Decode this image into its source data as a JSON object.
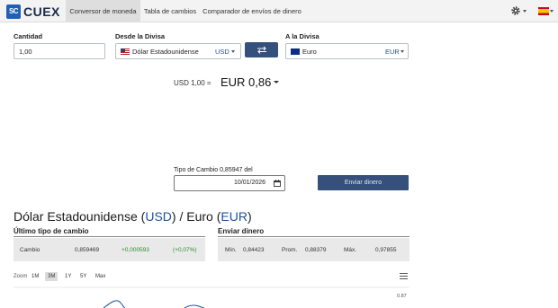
{
  "brand": {
    "mark": "SC",
    "name": "CUEX"
  },
  "nav": {
    "tabs": [
      {
        "label": "Conversor de moneda",
        "active": true
      },
      {
        "label": "Tabla de cambios",
        "active": false
      },
      {
        "label": "Comparador de envíos de dinero",
        "active": false
      }
    ],
    "settings_icon": "gear-icon",
    "language_icon": "flag-es-icon"
  },
  "form": {
    "amount_label": "Cantidad",
    "amount_value": "1,00",
    "from_label": "Desde la Divisa",
    "from_name": "Dólar Estadounidense",
    "from_code": "USD",
    "swap_icon": "swap-arrows-icon",
    "to_label": "A la Divisa",
    "to_name": "Euro",
    "to_code": "EUR"
  },
  "result": {
    "from_text": "USD 1,00 =",
    "to_text": "EUR 0,86"
  },
  "rate": {
    "label": "Tipo de Cambio 0,85947 del",
    "date": "10/01/2026",
    "send_button": "Enviar dinero"
  },
  "pair": {
    "base_name": "Dólar Estadounidense",
    "base_code": "USD",
    "quote_name": "Euro",
    "quote_code": "EUR"
  },
  "stats": {
    "last_rate_header": "Último tipo de cambio",
    "change_label": "Cambio",
    "rate_value": "0,859469",
    "change_abs": "+0,000593",
    "change_pct": "(+0,07%)",
    "send_header": "Enviar dinero",
    "min_label": "Mín.",
    "min_value": "0,84423",
    "avg_label": "Prom.",
    "avg_value": "0,88379",
    "max_label": "Máx.",
    "max_value": "0,97855"
  },
  "chart": {
    "zoom_label": "Zoom",
    "zoom_options": [
      "1M",
      "3M",
      "1Y",
      "5Y",
      "Max"
    ],
    "zoom_active": "3M",
    "y_tick": "0.87",
    "accent_color": "#1e4f9c"
  },
  "colors": {
    "button": "#34507b",
    "accent": "#1e4f9c",
    "positive": "#2f8a2f"
  }
}
